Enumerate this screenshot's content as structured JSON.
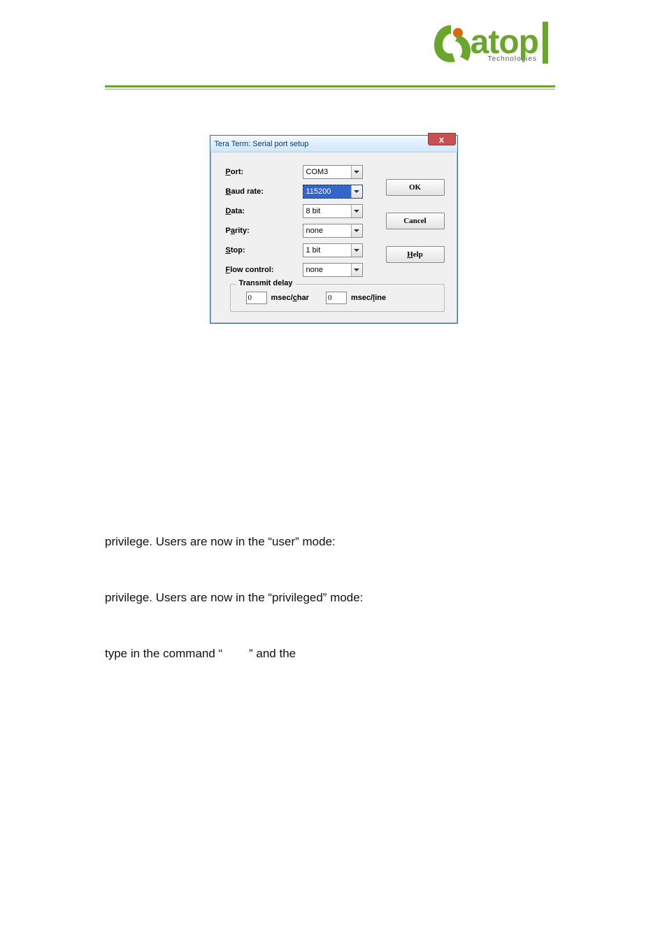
{
  "logo": {
    "word": "atop",
    "sub": "Technologies"
  },
  "dialog": {
    "title": "Tera Term: Serial port setup",
    "close": "x",
    "labels": {
      "port": "Port:",
      "baud": "Baud rate:",
      "data": "Data:",
      "parity": "Parity:",
      "stop": "Stop:",
      "flow": "Flow control:"
    },
    "values": {
      "port": "COM3",
      "baud": "115200",
      "data": "8 bit",
      "parity": "none",
      "stop": "1 bit",
      "flow": "none"
    },
    "buttons": {
      "ok": "OK",
      "cancel": "Cancel",
      "help": "Help"
    },
    "fieldset": {
      "legend": "Transmit delay",
      "char_value": "0",
      "char_label": "msec/char",
      "line_value": "0",
      "line_label": "msec/line"
    }
  },
  "body": {
    "line1": "privilege. Users are now in the “user” mode:",
    "line2": "privilege. Users are now in the “privileged” mode:",
    "line3_a": "type in the command “",
    "line3_b": "” and the"
  }
}
